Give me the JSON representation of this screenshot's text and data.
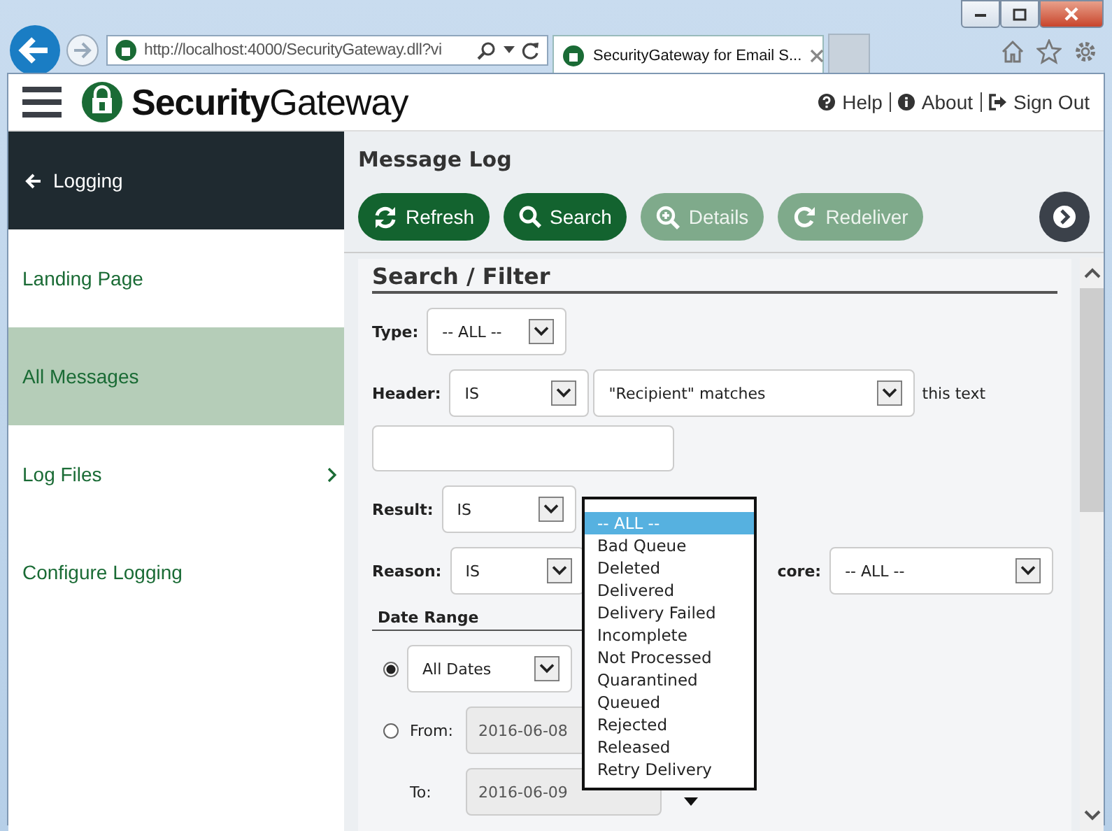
{
  "browser": {
    "address": "http://localhost:4000/SecurityGateway.dll?vi",
    "tab_title": "SecurityGateway for Email S..."
  },
  "header": {
    "logo_bold": "Security",
    "logo_light": "Gateway",
    "links": [
      "Help",
      "About",
      "Sign Out"
    ]
  },
  "sidebar": {
    "back": "Logging",
    "items": [
      {
        "label": "Landing Page",
        "selected": false,
        "submenu": false
      },
      {
        "label": "All Messages",
        "selected": true,
        "submenu": false
      },
      {
        "label": "Log Files",
        "selected": false,
        "submenu": true
      },
      {
        "label": "Configure Logging",
        "selected": false,
        "submenu": false
      }
    ]
  },
  "main": {
    "title": "Message Log",
    "buttons": [
      {
        "label": "Refresh",
        "disabled": false
      },
      {
        "label": "Search",
        "disabled": false
      },
      {
        "label": "Details",
        "disabled": true
      },
      {
        "label": "Redeliver",
        "disabled": true
      }
    ]
  },
  "filter": {
    "title": "Search / Filter",
    "type": {
      "label": "Type:",
      "value": "-- ALL --"
    },
    "header": {
      "label": "Header:",
      "op": "IS",
      "field": "\"Recipient\" matches",
      "suffix": "this text"
    },
    "result": {
      "label": "Result:",
      "op": "IS"
    },
    "reason": {
      "label": "Reason:",
      "op": "IS"
    },
    "score": {
      "label": "core:",
      "value": "-- ALL --"
    },
    "date_range": {
      "title": "Date Range",
      "all": {
        "selected": true,
        "value": "All Dates"
      },
      "from": {
        "selected": false,
        "label": "From:",
        "value": "2016-06-08"
      },
      "to": {
        "label": "To:",
        "value": "2016-06-09"
      }
    },
    "listbox": [
      {
        "label": "-- ALL --",
        "selected": true
      },
      {
        "label": "Bad Queue",
        "selected": false
      },
      {
        "label": "Deleted",
        "selected": false
      },
      {
        "label": "Delivered",
        "selected": false
      },
      {
        "label": "Delivery Failed",
        "selected": false
      },
      {
        "label": "Incomplete",
        "selected": false
      },
      {
        "label": "Not Processed",
        "selected": false
      },
      {
        "label": "Quarantined",
        "selected": false
      },
      {
        "label": "Queued",
        "selected": false
      },
      {
        "label": "Rejected",
        "selected": false
      },
      {
        "label": "Released",
        "selected": false
      },
      {
        "label": "Retry Delivery",
        "selected": false
      }
    ]
  }
}
